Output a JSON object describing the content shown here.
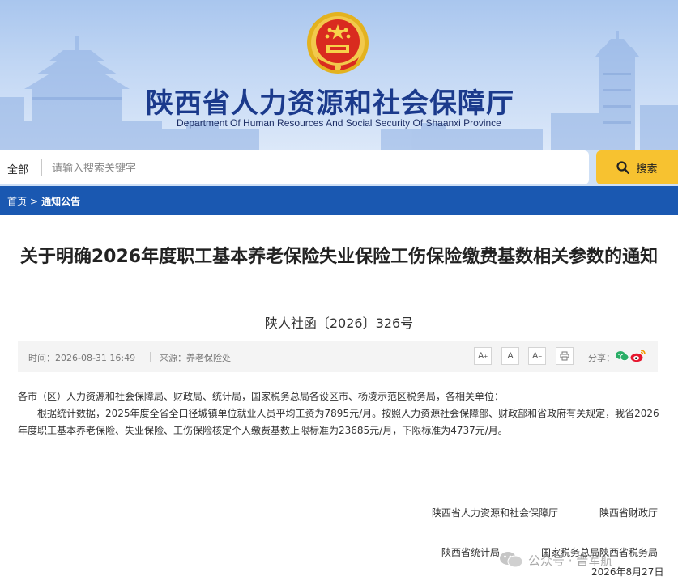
{
  "header": {
    "title": "陕西省人力资源和社会保障厅",
    "subtitle": "Department Of Human Resources And Social Security Of Shaanxi Province"
  },
  "search": {
    "scope": "全部",
    "placeholder": "请输入搜索关键字",
    "value": "",
    "button_label": "搜索"
  },
  "breadcrumb": {
    "home": "首页",
    "separator": ">",
    "current": "通知公告"
  },
  "article": {
    "title": "关于明确2026年度职工基本养老保险失业保险工伤保险缴费基数相关参数的通知",
    "doc_number": "陕人社函〔2026〕326号",
    "meta": {
      "time": "时间：2026-08-31 16:49",
      "source": "来源：养老保险处",
      "share_label": "分享："
    },
    "tools": {
      "font_larger": "A",
      "font_normal": "A",
      "font_smaller": "A"
    },
    "salutation": "各市（区）人力资源和社会保障局、财政局、统计局，国家税务总局各设区市、杨凌示范区税务局，各相关单位：",
    "paragraph": "根据统计数据，2025年度全省全口径城镇单位就业人员平均工资为7895元/月。按照人力资源社会保障部、财政部和省政府有关规定，我省2026年度职工基本养老保险、失业保险、工伤保险核定个人缴费基数上限标准为23685元/月，下限标准为4737元/月。",
    "signatures": {
      "hrss": "陕西省人力资源和社会保障厅",
      "finance": "陕西省财政厅",
      "stats": "陕西省统计局",
      "tax": "国家税务总局陕西省税务局",
      "date": "2026年8月27日"
    }
  },
  "watermark": {
    "text": "公众号 · 晋军航"
  },
  "colors": {
    "banner_sky": "#b8d0f2",
    "title_blue": "#1b3a8c",
    "breadcrumb_bar": "#1a58b1",
    "search_button": "#f7c230",
    "meta_bar": "#f4f4f4",
    "wechat_green": "#2aae67",
    "weibo_red": "#e6162d"
  },
  "icons": {
    "emblem": "national-emblem-icon",
    "search": "magnifier-icon",
    "print": "print-icon",
    "wechat": "wechat-icon",
    "weibo": "weibo-icon"
  }
}
